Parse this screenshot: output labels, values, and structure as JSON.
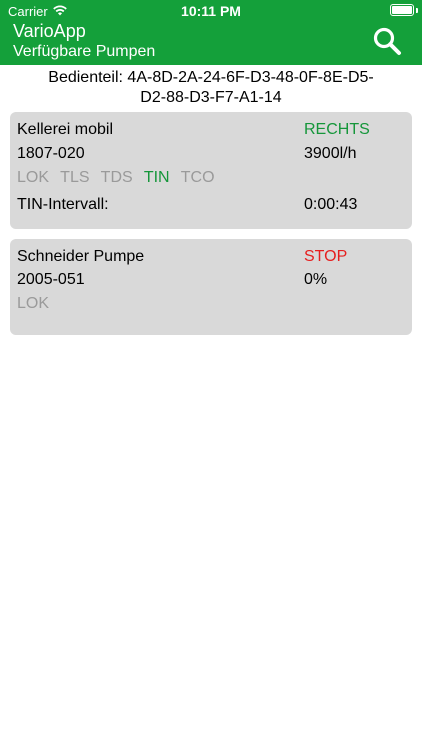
{
  "status_bar": {
    "carrier": "Carrier",
    "time": "10:11 PM",
    "icons": [
      "wifi-icon",
      "battery-icon"
    ]
  },
  "header": {
    "title": "VarioApp",
    "subtitle": "Verfügbare Pumpen",
    "search_icon": "search-icon",
    "bg_color": "#14a03a"
  },
  "panel": {
    "label": "Bedienteil: 4A-8D-2A-24-6F-D3-48-0F-8E-D5-",
    "label_line2": "D2-88-D3-F7-A1-14"
  },
  "pumps": [
    {
      "name": "Kellerei mobil",
      "status": "RECHTS",
      "status_color": "#15963a",
      "id": "1807-020",
      "flow": "3900l/h",
      "flags": [
        {
          "label": "LOK",
          "active": false
        },
        {
          "label": "TLS",
          "active": false
        },
        {
          "label": "TDS",
          "active": false
        },
        {
          "label": "TIN",
          "active": true
        },
        {
          "label": "TCO",
          "active": false
        }
      ],
      "interval_label": "TIN-Intervall:",
      "interval_value": "0:00:43"
    },
    {
      "name": "Schneider Pumpe",
      "status": "STOP",
      "status_color": "#e61e1e",
      "id": "2005-051",
      "flow": "0%",
      "flags": [
        {
          "label": "LOK",
          "active": false
        }
      ]
    }
  ]
}
